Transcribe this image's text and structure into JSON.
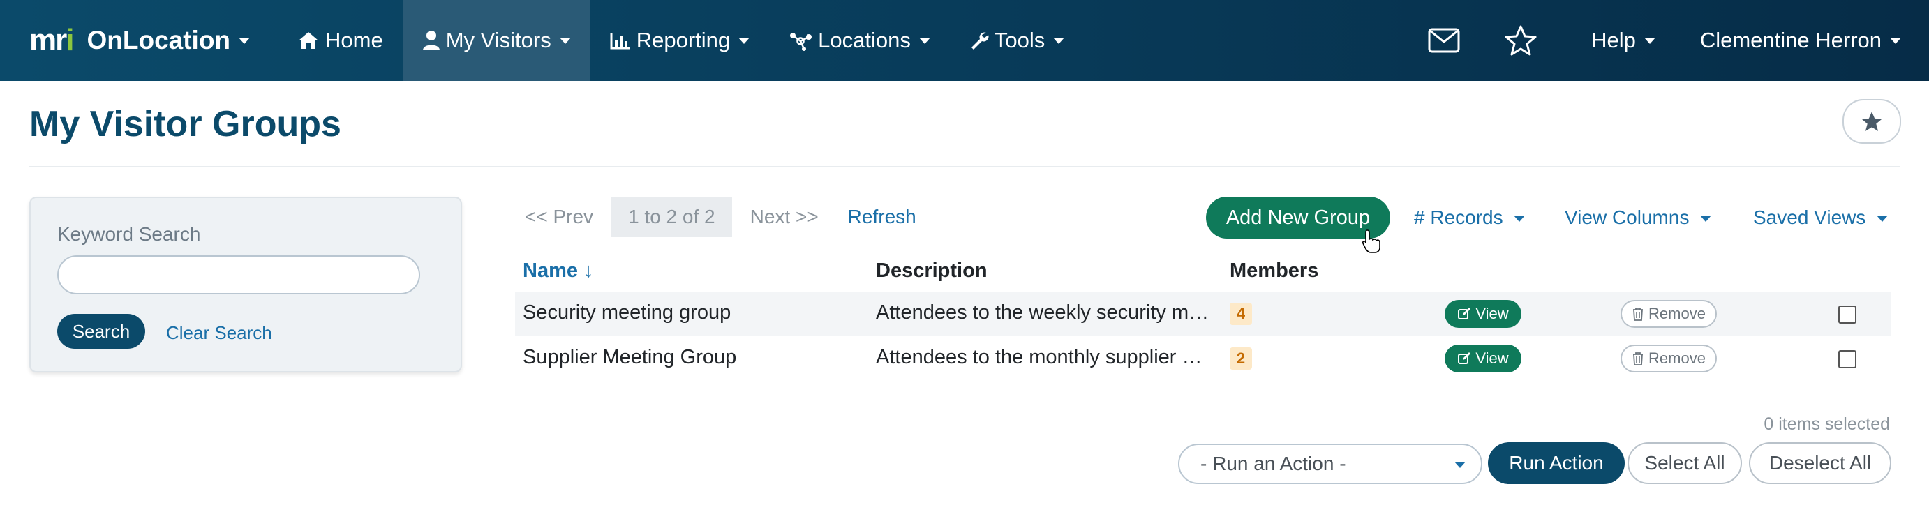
{
  "navbar": {
    "logo_text": "mri",
    "brand": "OnLocation",
    "items": [
      {
        "label": "Home",
        "icon": "home-icon"
      },
      {
        "label": "My Visitors",
        "icon": "user-icon"
      },
      {
        "label": "Reporting",
        "icon": "bar-chart-icon"
      },
      {
        "label": "Locations",
        "icon": "network-icon"
      },
      {
        "label": "Tools",
        "icon": "wrench-icon"
      }
    ],
    "help": "Help",
    "user": "Clementine Herron"
  },
  "page": {
    "title": "My Visitor Groups"
  },
  "search": {
    "label": "Keyword Search",
    "value": "",
    "placeholder": "",
    "search_button": "Search",
    "clear_link": "Clear Search"
  },
  "pager": {
    "prev": "<< Prev",
    "count": "1 to 2 of 2",
    "next": "Next >>",
    "refresh": "Refresh"
  },
  "toolbar": {
    "add_group": "Add New Group",
    "records": "# Records",
    "view_columns": "View Columns",
    "saved_views": "Saved Views"
  },
  "table": {
    "headers": {
      "name": "Name ↓",
      "description": "Description",
      "members": "Members"
    },
    "rows": [
      {
        "name": "Security meeting group",
        "description": "Attendees to the weekly security meeting",
        "members": "4",
        "view": "View",
        "remove": "Remove"
      },
      {
        "name": "Supplier Meeting Group",
        "description": "Attendees to the monthly supplier meeting",
        "members": "2",
        "view": "View",
        "remove": "Remove"
      }
    ]
  },
  "actions": {
    "selected_count": "0 items selected",
    "run_action_placeholder": "- Run an Action -",
    "run_action": "Run Action",
    "select_all": "Select All",
    "deselect_all": "Deselect All"
  },
  "colors": {
    "navbar": "#0b4a6a",
    "primary": "#0b4a6a",
    "success": "#0f7a5a",
    "link": "#1a6fa8",
    "badge_bg": "#fde9c8",
    "badge_text": "#c46a00"
  }
}
